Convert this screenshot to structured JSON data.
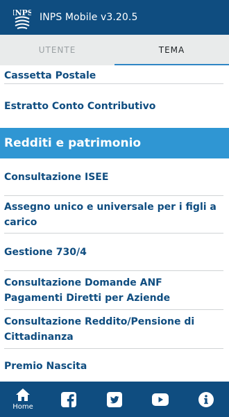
{
  "appbar": {
    "title": "INPS Mobile v3.20.5",
    "logo_text": "INPS"
  },
  "tabs": [
    {
      "label": "UTENTE",
      "active": false
    },
    {
      "label": "TEMA",
      "active": true
    }
  ],
  "list": {
    "items_top": [
      "Cassetta Postale",
      "Estratto Conto Contributivo"
    ],
    "section_title": "Redditi e patrimonio",
    "items": [
      "Consultazione ISEE",
      "Assegno unico e universale per i figli a carico",
      "Gestione 730/4",
      "Consultazione Domande ANF Pagamenti Diretti per Aziende",
      "Consultazione Reddito/Pensione di Cittadinanza",
      "Premio Nascita"
    ]
  },
  "bottom_nav": {
    "home_label": "Home",
    "icons": [
      "home-icon",
      "facebook-icon",
      "twitter-icon",
      "youtube-icon",
      "info-icon"
    ]
  },
  "colors": {
    "brand": "#0f4d80",
    "accent": "#2f96d3",
    "tab_bg": "#e9ebeb",
    "tab_indicator": "#2f86c4"
  }
}
